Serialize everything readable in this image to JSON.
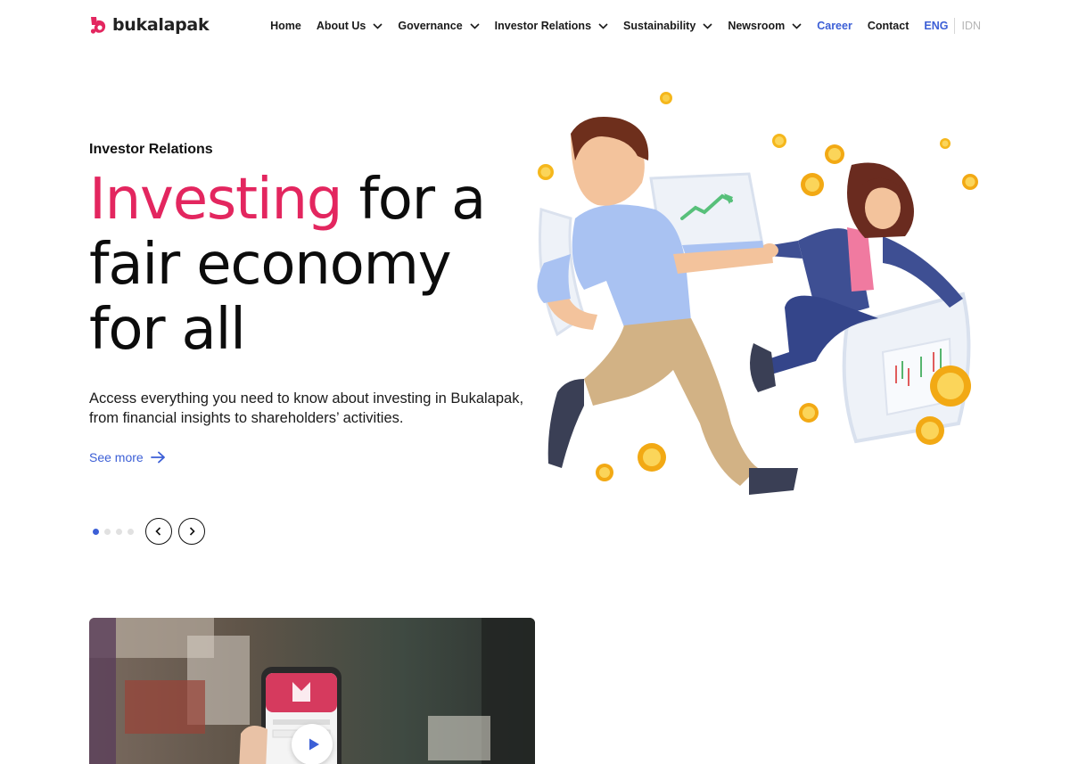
{
  "brand": {
    "name": "bukalapak",
    "color": "#e3265f"
  },
  "nav": {
    "home": "Home",
    "about": "About Us",
    "governance": "Governance",
    "investor_relations": "Investor Relations",
    "sustainability": "Sustainability",
    "newsroom": "Newsroom",
    "career": "Career",
    "contact": "Contact",
    "lang_active": "ENG",
    "lang_other": "IDN",
    "chevron_icon": "chevron-down-icon"
  },
  "hero": {
    "eyebrow": "Investor Relations",
    "headline_accent": "Investing",
    "headline_rest_1": " for a",
    "headline_rest_2": "fair economy",
    "headline_rest_3": "for all",
    "description": "Access everything you need to know about investing in Bukalapak, from financial insights to shareholders’ activities.",
    "cta": "See more",
    "slides_total": 4,
    "slide_active": 1
  },
  "colors": {
    "accent_blue": "#3c5fd6",
    "accent_pink": "#e3265f",
    "text": "#111111"
  },
  "icons": {
    "cta": "arrow-right-icon",
    "prev": "chevron-left-icon",
    "next": "chevron-right-icon",
    "play": "play-icon"
  }
}
